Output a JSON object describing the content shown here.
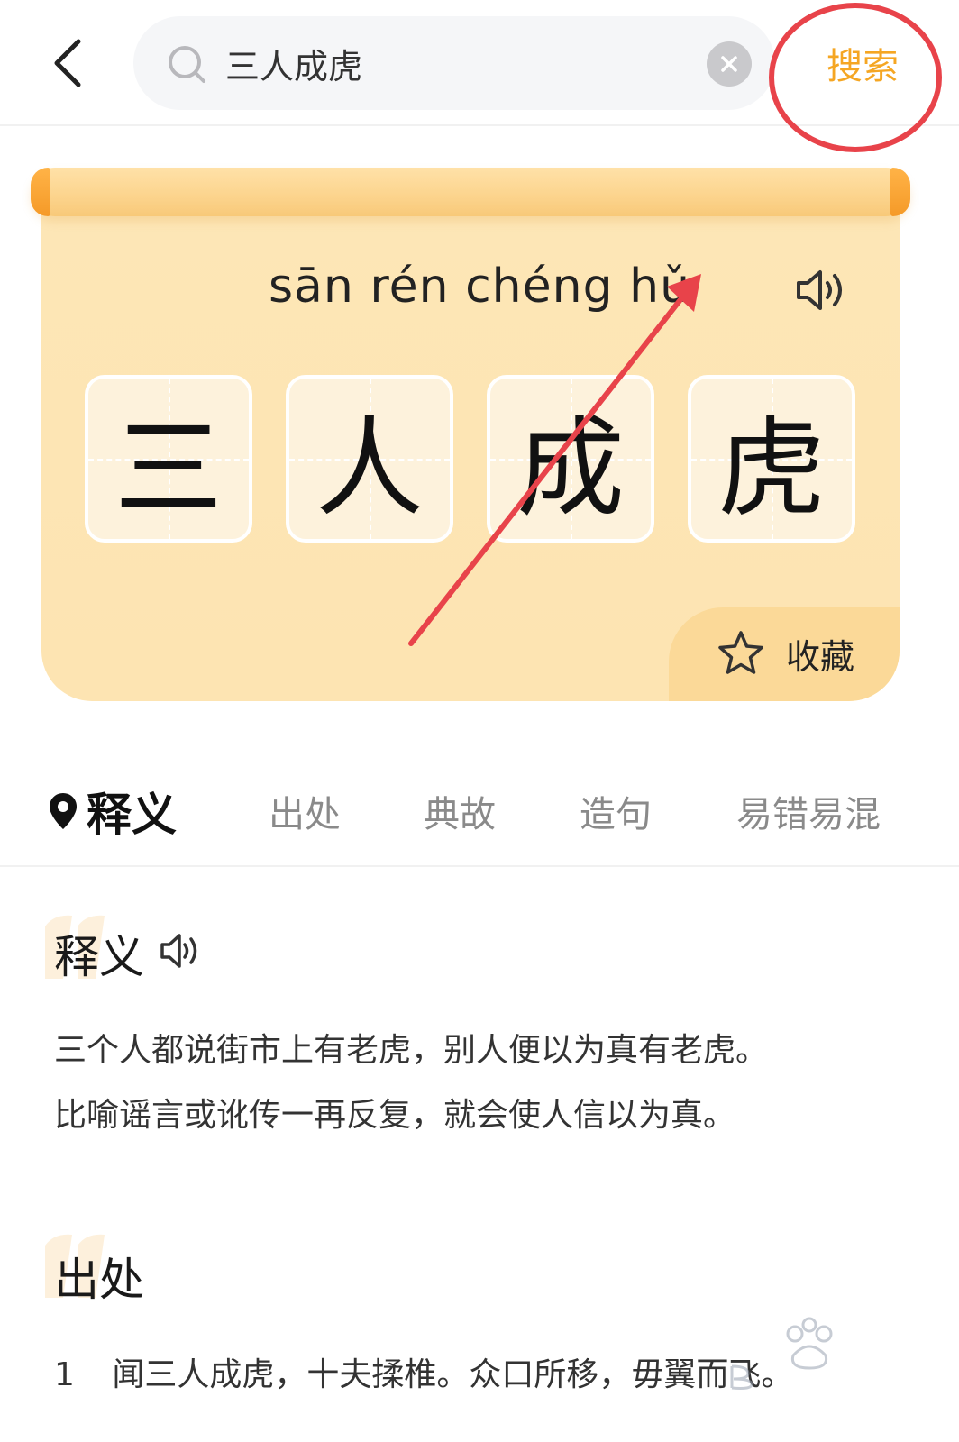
{
  "search": {
    "query": "三人成虎",
    "submit_label": "搜索"
  },
  "idiom": {
    "pinyin": "sān rén chéng hǔ",
    "characters": [
      "三",
      "人",
      "成",
      "虎"
    ],
    "favorite_label": "收藏"
  },
  "tabs": [
    {
      "label": "释义",
      "active": true
    },
    {
      "label": "出处",
      "active": false
    },
    {
      "label": "典故",
      "active": false
    },
    {
      "label": "造句",
      "active": false
    },
    {
      "label": "易错易混",
      "active": false
    }
  ],
  "meaning": {
    "title": "释义",
    "lines": [
      "三个人都说街市上有老虎，别人便以为真有老虎。",
      "比喻谣言或讹传一再反复，就会使人信以为真。"
    ]
  },
  "source": {
    "title": "出处",
    "items": [
      {
        "num": "1",
        "text": "闻三人成虎，十夫揉椎。众口所移，毋翼而飞。"
      }
    ]
  },
  "colors": {
    "accent": "#f5a623",
    "card_bg": "#fde4b2",
    "annotation": "#e8434a"
  }
}
